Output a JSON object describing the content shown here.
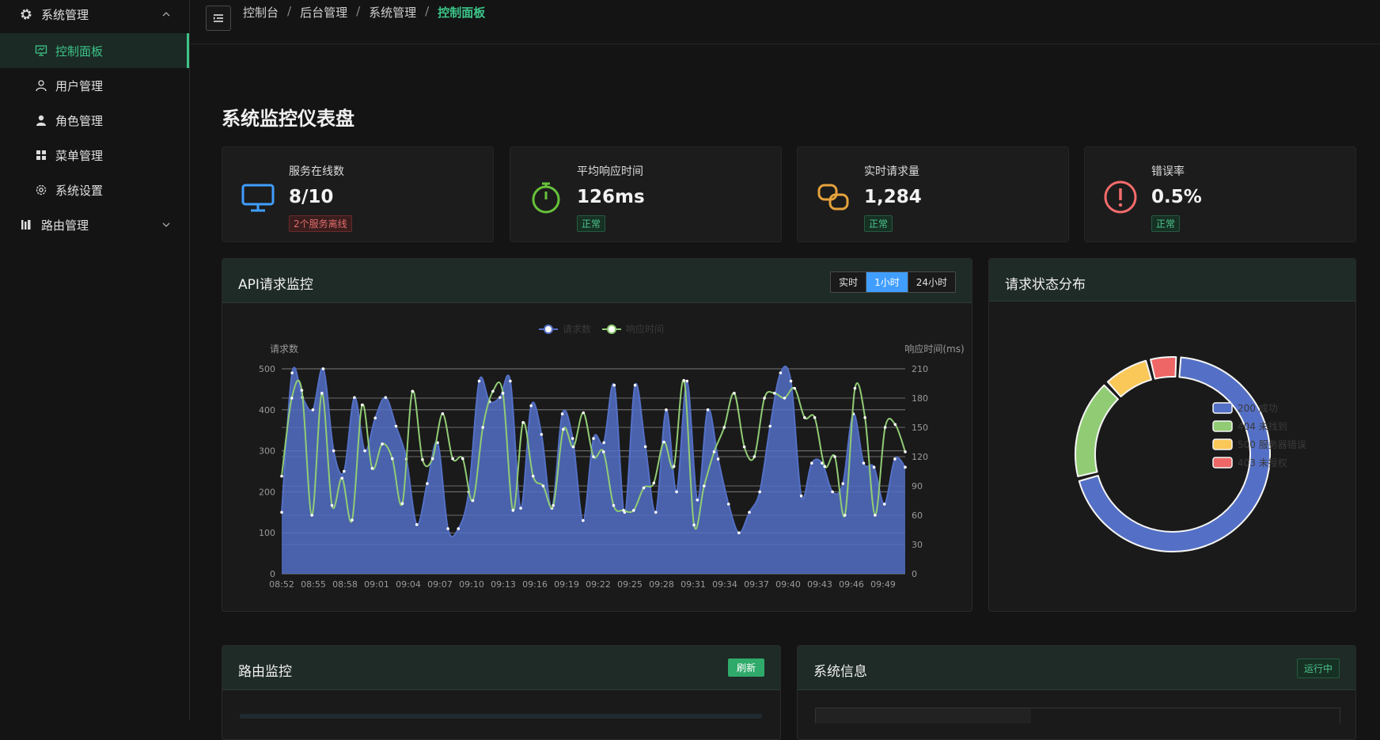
{
  "sidebar": {
    "groups": [
      {
        "label": "系统管理",
        "icon": "gear-icon"
      },
      {
        "label": "路由管理",
        "icon": "route-icon"
      }
    ],
    "items": [
      {
        "label": "控制面板",
        "icon": "dashboard-icon",
        "active": true
      },
      {
        "label": "用户管理",
        "icon": "user-icon"
      },
      {
        "label": "角色管理",
        "icon": "role-icon"
      },
      {
        "label": "菜单管理",
        "icon": "menu-grid-icon"
      },
      {
        "label": "系统设置",
        "icon": "settings-icon"
      }
    ]
  },
  "breadcrumb": [
    "控制台",
    "后台管理",
    "系统管理",
    "控制面板"
  ],
  "page_title": "系统监控仪表盘",
  "stats": [
    {
      "label": "服务在线数",
      "value": "8/10",
      "tag": "2个服务离线",
      "tag_type": "danger",
      "icon": "monitor-icon",
      "color": "#409eff"
    },
    {
      "label": "平均响应时间",
      "value": "126ms",
      "tag": "正常",
      "tag_type": "success",
      "icon": "stopwatch-icon",
      "color": "#67c23a"
    },
    {
      "label": "实时请求量",
      "value": "1,284",
      "tag": "正常",
      "tag_type": "success",
      "icon": "link-icon",
      "color": "#e6a23c"
    },
    {
      "label": "错误率",
      "value": "0.5%",
      "tag": "正常",
      "tag_type": "success",
      "icon": "alert-icon",
      "color": "#f56c6c"
    }
  ],
  "api_panel": {
    "title": "API请求监控",
    "ranges": [
      "实时",
      "1小时",
      "24小时"
    ],
    "selected": "1小时"
  },
  "status_panel": {
    "title": "请求状态分布"
  },
  "route_panel": {
    "title": "路由监控",
    "button": "刷新"
  },
  "sysinfo_panel": {
    "title": "系统信息",
    "badge": "运行中"
  },
  "chart_data": [
    {
      "type": "line",
      "legend": [
        "请求数",
        "响应时间"
      ],
      "y_left_label": "请求数",
      "y_right_label": "响应时间(ms)",
      "y_left_ticks": [
        0,
        100,
        200,
        300,
        400,
        500
      ],
      "y_right_ticks": [
        0,
        30,
        60,
        90,
        120,
        150,
        180,
        210
      ],
      "ylim_left": [
        0,
        500
      ],
      "ylim_right": [
        0,
        210
      ],
      "x_ticks": [
        "08:52",
        "08:55",
        "08:58",
        "09:01",
        "09:04",
        "09:07",
        "09:10",
        "09:13",
        "09:16",
        "09:19",
        "09:22",
        "09:25",
        "09:28",
        "09:31",
        "09:34",
        "09:37",
        "09:40",
        "09:43",
        "09:46",
        "09:49"
      ],
      "series": [
        {
          "name": "请求数",
          "color": "#5470c6",
          "area": true,
          "axis": "left",
          "values": [
            150,
            490,
            430,
            400,
            500,
            300,
            250,
            430,
            300,
            380,
            430,
            360,
            280,
            120,
            220,
            320,
            110,
            110,
            200,
            470,
            420,
            430,
            470,
            160,
            410,
            340,
            160,
            390,
            330,
            130,
            330,
            320,
            460,
            150,
            460,
            310,
            150,
            400,
            200,
            470,
            180,
            400,
            280,
            170,
            100,
            150,
            200,
            360,
            490,
            470,
            190,
            270,
            270,
            200,
            220,
            390,
            270,
            260,
            170,
            280,
            260
          ]
        },
        {
          "name": "响应时间",
          "color": "#91cc75",
          "area": false,
          "axis": "right",
          "values": [
            100,
            180,
            188,
            60,
            185,
            70,
            98,
            55,
            173,
            108,
            133,
            118,
            72,
            187,
            117,
            118,
            164,
            118,
            118,
            75,
            150,
            187,
            185,
            65,
            155,
            100,
            90,
            70,
            148,
            130,
            165,
            120,
            125,
            70,
            65,
            65,
            88,
            93,
            135,
            110,
            198,
            50,
            90,
            125,
            150,
            185,
            130,
            120,
            180,
            185,
            180,
            190,
            160,
            160,
            110,
            120,
            60,
            190,
            160,
            60,
            150,
            153,
            125
          ]
        }
      ]
    },
    {
      "type": "pie",
      "donut": true,
      "legend": [
        "200 成功",
        "404 未找到",
        "500 服务器错误",
        "403 未授权"
      ],
      "values": [
        70,
        17,
        8,
        5
      ],
      "colors": [
        "#5470c6",
        "#91cc75",
        "#fac858",
        "#ee6666"
      ]
    }
  ]
}
